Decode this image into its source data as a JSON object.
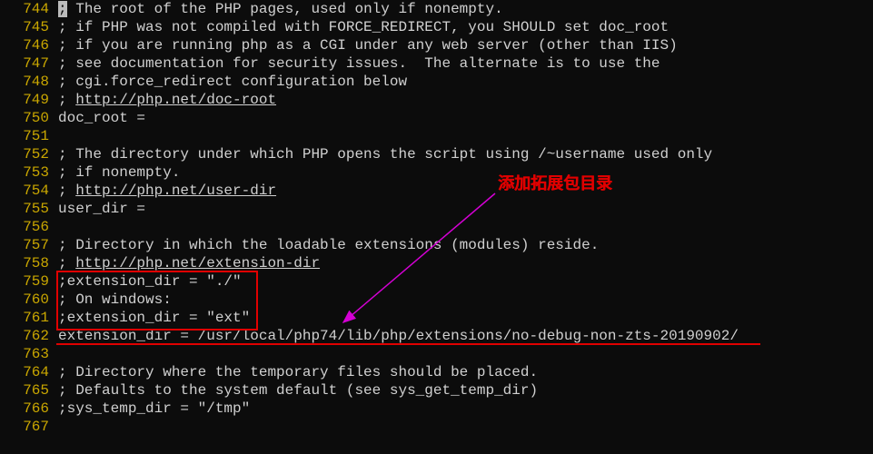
{
  "annotation": {
    "label": "添加拓展包目录"
  },
  "lines": [
    {
      "num": "744",
      "segs": [
        {
          "t": ";",
          "cls": "cursor"
        },
        {
          "t": " The root of the PHP pages, used only if nonempty."
        }
      ]
    },
    {
      "num": "745",
      "segs": [
        {
          "t": "; if PHP was not compiled with FORCE_REDIRECT, you SHOULD set doc_root"
        }
      ]
    },
    {
      "num": "746",
      "segs": [
        {
          "t": "; if you are running php as a CGI under any web server (other than IIS)"
        }
      ]
    },
    {
      "num": "747",
      "segs": [
        {
          "t": "; see documentation for security issues.  The alternate is to use the"
        }
      ]
    },
    {
      "num": "748",
      "segs": [
        {
          "t": "; cgi.force_redirect configuration below"
        }
      ]
    },
    {
      "num": "749",
      "segs": [
        {
          "t": "; "
        },
        {
          "t": "http://php.net/doc-root",
          "cls": "link"
        }
      ]
    },
    {
      "num": "750",
      "segs": [
        {
          "t": "doc_root ="
        }
      ]
    },
    {
      "num": "751",
      "segs": [
        {
          "t": ""
        }
      ]
    },
    {
      "num": "752",
      "segs": [
        {
          "t": "; The directory under which PHP opens the script using /~username used only"
        }
      ]
    },
    {
      "num": "753",
      "segs": [
        {
          "t": "; if nonempty."
        }
      ]
    },
    {
      "num": "754",
      "segs": [
        {
          "t": "; "
        },
        {
          "t": "http://php.net/user-dir",
          "cls": "link"
        }
      ]
    },
    {
      "num": "755",
      "segs": [
        {
          "t": "user_dir ="
        }
      ]
    },
    {
      "num": "756",
      "segs": [
        {
          "t": ""
        }
      ]
    },
    {
      "num": "757",
      "segs": [
        {
          "t": "; Directory in which the loadable extensions (modules) reside."
        }
      ]
    },
    {
      "num": "758",
      "segs": [
        {
          "t": "; "
        },
        {
          "t": "http://php.net/extension-dir",
          "cls": "link"
        }
      ]
    },
    {
      "num": "759",
      "segs": [
        {
          "t": ";extension_dir = \"./\""
        }
      ]
    },
    {
      "num": "760",
      "segs": [
        {
          "t": "; On windows:"
        }
      ]
    },
    {
      "num": "761",
      "segs": [
        {
          "t": ";extension_dir = \"ext\""
        }
      ]
    },
    {
      "num": "762",
      "segs": [
        {
          "t": "extension_dir = /usr/local/php74/lib/php/extensions/no-debug-non-zts-20190902/"
        }
      ]
    },
    {
      "num": "763",
      "segs": [
        {
          "t": ""
        }
      ]
    },
    {
      "num": "764",
      "segs": [
        {
          "t": "; Directory where the temporary files should be placed."
        }
      ]
    },
    {
      "num": "765",
      "segs": [
        {
          "t": "; Defaults to the system default (see sys_get_temp_dir)"
        }
      ]
    },
    {
      "num": "766",
      "segs": [
        {
          "t": ";sys_temp_dir = \"/tmp\""
        }
      ]
    },
    {
      "num": "767",
      "segs": [
        {
          "t": ""
        }
      ]
    }
  ]
}
